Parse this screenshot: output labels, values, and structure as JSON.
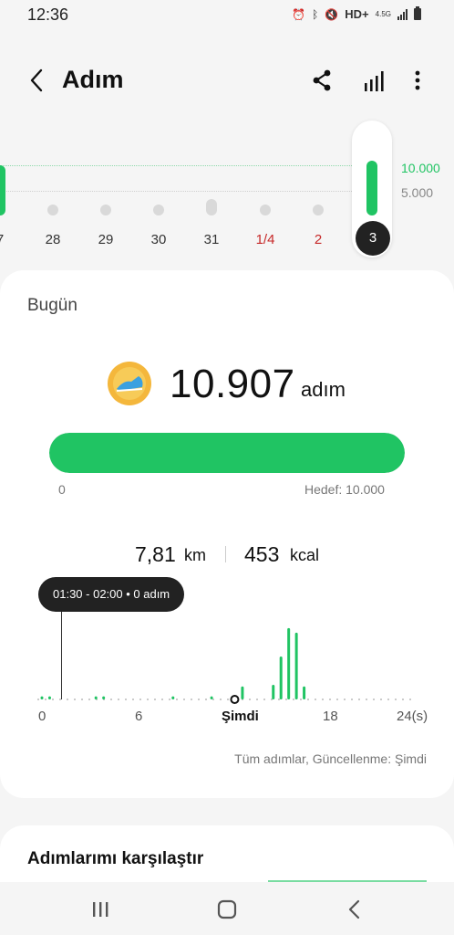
{
  "status": {
    "time": "12:36",
    "network": "HD+",
    "network_sub": "4.5G"
  },
  "header": {
    "title": "Adım",
    "back_icon": "chevron-left-icon",
    "share_icon": "share-icon",
    "stats_icon": "bar-chart-icon",
    "more_icon": "more-vertical-icon"
  },
  "week": {
    "days": [
      {
        "label": "7",
        "red": false,
        "steps_fraction": 1.0
      },
      {
        "label": "28",
        "red": false,
        "steps_fraction": 0.1
      },
      {
        "label": "29",
        "red": false,
        "steps_fraction": 0.14
      },
      {
        "label": "30",
        "red": false,
        "steps_fraction": 0.13
      },
      {
        "label": "31",
        "red": false,
        "steps_fraction": 0.32
      },
      {
        "label": "1/4",
        "red": true,
        "steps_fraction": 0.06
      },
      {
        "label": "2",
        "red": true,
        "steps_fraction": 0.07
      },
      {
        "label": "3",
        "red": false,
        "steps_fraction": 1.09,
        "selected": true
      }
    ],
    "goal_label": "10.000",
    "half_label": "5.000"
  },
  "today": {
    "label": "Bugün",
    "steps": "10.907",
    "steps_unit": "adım",
    "badge_icon": "running-shoe-badge-icon",
    "progress": 1.0,
    "progress_min": "0",
    "goal_text": "Hedef: 10.000",
    "distance": "7,81",
    "distance_unit": "km",
    "calories": "453",
    "calories_unit": "kcal"
  },
  "hourly": {
    "tooltip": "01:30 - 02:00 • 0 adım",
    "axis_labels": [
      "0",
      "6",
      "Şimdi",
      "18",
      "24(s)"
    ],
    "update_note": "Tüm adımlar, Güncellenme: Şimdi",
    "bars": [
      {
        "hour": 15.0,
        "value": 0.19
      },
      {
        "hour": 15.5,
        "value": 0.56
      },
      {
        "hour": 16.0,
        "value": 0.93
      },
      {
        "hour": 16.5,
        "value": 0.87
      },
      {
        "hour": 17.0,
        "value": 0.17
      },
      {
        "hour": 13.0,
        "value": 0.17
      },
      {
        "hour": 11.0,
        "value": 0.04
      },
      {
        "hour": 8.5,
        "value": 0.04
      },
      {
        "hour": 4.0,
        "value": 0.04
      },
      {
        "hour": 3.5,
        "value": 0.04
      },
      {
        "hour": 0.5,
        "value": 0.04
      },
      {
        "hour": 0.0,
        "value": 0.04
      }
    ]
  },
  "compare": {
    "title": "Adımlarımı karşılaştır"
  },
  "nav": {
    "recents_icon": "recents-icon",
    "home_icon": "home-icon",
    "back_icon": "back-icon"
  },
  "colors": {
    "accent": "#20c463",
    "sunday_red": "#c62828",
    "tooltip_bg": "#222222"
  }
}
